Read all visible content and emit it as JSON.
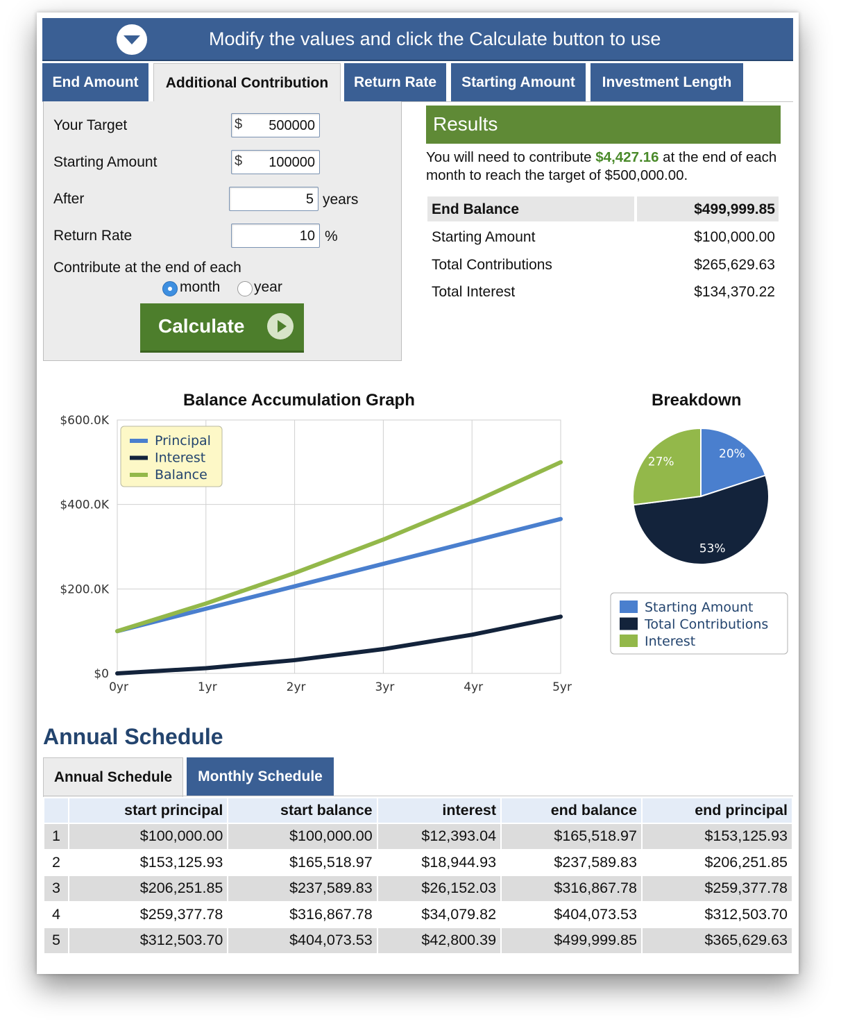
{
  "banner": {
    "text": "Modify the values and click the Calculate button to use"
  },
  "tabs": [
    {
      "label": "End Amount",
      "active": false
    },
    {
      "label": "Additional Contribution",
      "active": true
    },
    {
      "label": "Return Rate",
      "active": false
    },
    {
      "label": "Starting Amount",
      "active": false
    },
    {
      "label": "Investment Length",
      "active": false
    }
  ],
  "form": {
    "target_label": "Your Target",
    "target_currency": "$",
    "target_value": "500000",
    "starting_label": "Starting Amount",
    "starting_currency": "$",
    "starting_value": "100000",
    "after_label": "After",
    "after_value": "5",
    "after_unit": "years",
    "rate_label": "Return Rate",
    "rate_value": "10",
    "rate_unit": "%",
    "contribute_label": "Contribute at the end of each",
    "option_month": "month",
    "option_year": "year",
    "selected_option": "month",
    "calculate_label": "Calculate"
  },
  "results": {
    "title": "Results",
    "text_before": "You will need to contribute ",
    "amount": "$4,427.16",
    "text_after": " at the end of each month to reach the target of $500,000.00.",
    "rows": [
      {
        "label": "End Balance",
        "value": "$499,999.85",
        "bold": true
      },
      {
        "label": "Starting Amount",
        "value": "$100,000.00"
      },
      {
        "label": "Total Contributions",
        "value": "$265,629.63"
      },
      {
        "label": "Total Interest",
        "value": "$134,370.22"
      }
    ]
  },
  "chart_data": [
    {
      "type": "line",
      "title": "Balance Accumulation Graph",
      "x": [
        "0yr",
        "1yr",
        "2yr",
        "3yr",
        "4yr",
        "5yr"
      ],
      "y_ticks": [
        "$0",
        "$200.0K",
        "$400.0K",
        "$600.0K"
      ],
      "ylim": [
        0,
        600000
      ],
      "grid": true,
      "legend_position": "top-left",
      "series": [
        {
          "name": "Principal",
          "color": "#4a7fce",
          "values": [
            100000,
            153125.93,
            206251.85,
            259377.78,
            312503.7,
            365629.63
          ]
        },
        {
          "name": "Interest",
          "color": "#13233b",
          "values": [
            0,
            12393.04,
            31337.97,
            57490.0,
            91569.82,
            134370.22
          ]
        },
        {
          "name": "Balance",
          "color": "#93b84a",
          "values": [
            100000,
            165518.97,
            237589.83,
            316867.78,
            404073.53,
            499999.85
          ]
        }
      ]
    },
    {
      "type": "pie",
      "title": "Breakdown",
      "legend_position": "bottom",
      "slices": [
        {
          "name": "Starting Amount",
          "value": 20,
          "label": "20%",
          "color": "#4a7fce"
        },
        {
          "name": "Total Contributions",
          "value": 53,
          "label": "53%",
          "color": "#13233b"
        },
        {
          "name": "Interest",
          "value": 27,
          "label": "27%",
          "color": "#93b84a"
        }
      ]
    }
  ],
  "schedule": {
    "title": "Annual Schedule",
    "tabs": [
      {
        "label": "Annual Schedule",
        "active": true
      },
      {
        "label": "Monthly Schedule",
        "active": false
      }
    ],
    "columns": [
      "",
      "start principal",
      "start balance",
      "interest",
      "end balance",
      "end principal"
    ],
    "rows": [
      [
        "1",
        "$100,000.00",
        "$100,000.00",
        "$12,393.04",
        "$165,518.97",
        "$153,125.93"
      ],
      [
        "2",
        "$153,125.93",
        "$165,518.97",
        "$18,944.93",
        "$237,589.83",
        "$206,251.85"
      ],
      [
        "3",
        "$206,251.85",
        "$237,589.83",
        "$26,152.03",
        "$316,867.78",
        "$259,377.78"
      ],
      [
        "4",
        "$259,377.78",
        "$316,867.78",
        "$34,079.82",
        "$404,073.53",
        "$312,503.70"
      ],
      [
        "5",
        "$312,503.70",
        "$404,073.53",
        "$42,800.39",
        "$499,999.85",
        "$365,629.63"
      ]
    ]
  }
}
